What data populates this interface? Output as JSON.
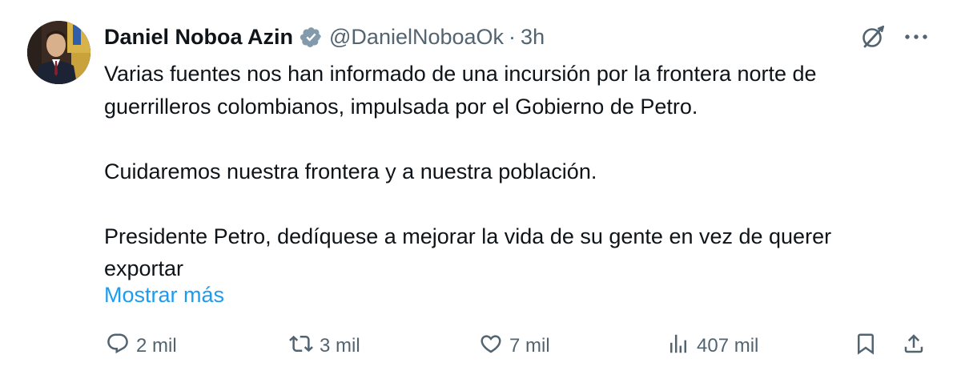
{
  "colors": {
    "text": "#0f1419",
    "muted": "#536471",
    "link": "#1d9bf0",
    "verified_badge": "#829aab"
  },
  "author": {
    "name": "Daniel Noboa Azin",
    "handle": "@DanielNoboaOk",
    "separator": "·",
    "time": "3h",
    "verified_icon": "verified-badge-icon"
  },
  "tweet": {
    "text": "Varias fuentes nos han informado de una incursión por la frontera norte de\nguerrilleros colombianos, impulsada por el Gobierno de Petro.\n\nCuidaremos nuestra frontera y a nuestra población.\n\nPresidente Petro, dedíquese a mejorar la vida de su gente en vez de querer\nexportar",
    "show_more": "Mostrar más"
  },
  "actions": {
    "replies": "2 mil",
    "reposts": "3 mil",
    "likes": "7 mil",
    "views": "407 mil"
  },
  "icons": {
    "grok": "grok-icon",
    "more": "more-icon",
    "reply": "reply-icon",
    "repost": "repost-icon",
    "like": "heart-icon",
    "views": "views-icon",
    "bookmark": "bookmark-icon",
    "share": "share-icon"
  }
}
